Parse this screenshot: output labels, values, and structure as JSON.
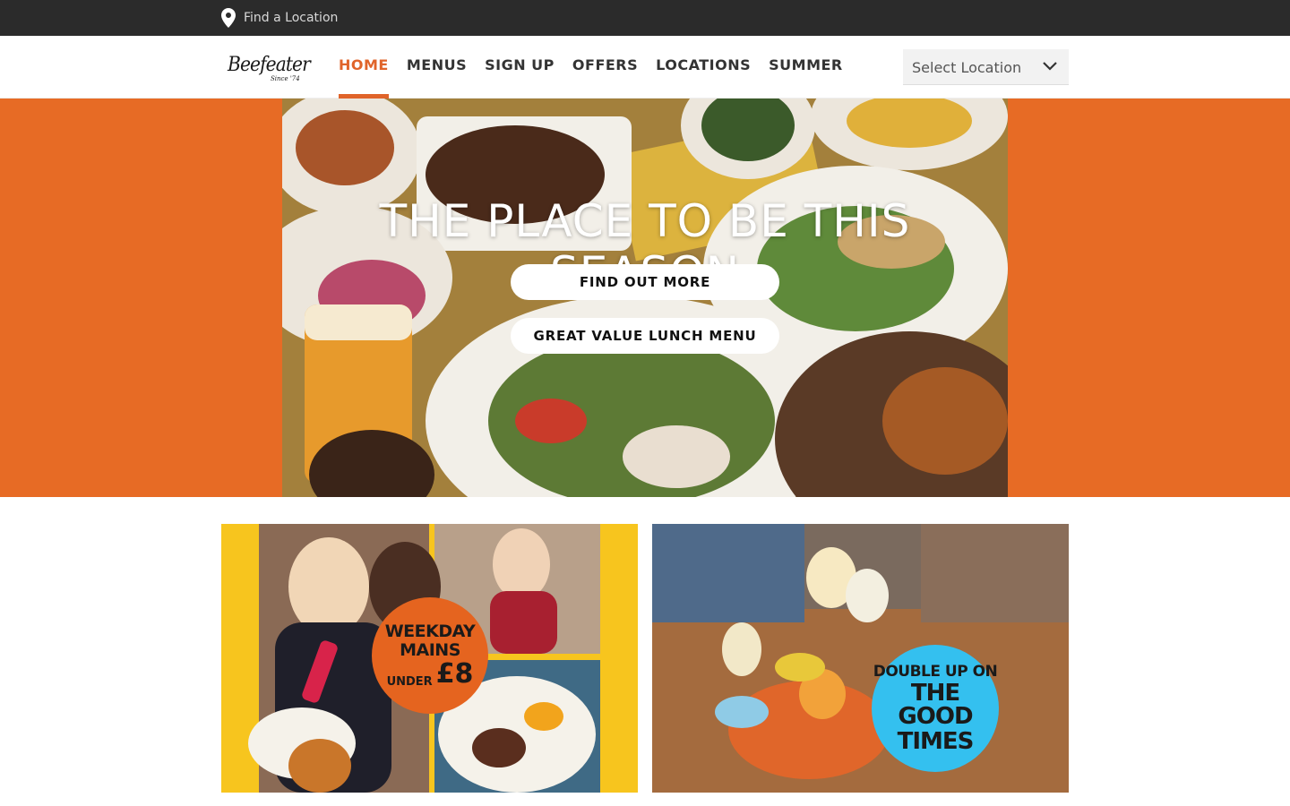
{
  "topbar": {
    "find_location": "Find a Location"
  },
  "brand": {
    "name": "Beefeater",
    "tagline": "Since '74"
  },
  "nav": {
    "items": [
      {
        "label": "HOME"
      },
      {
        "label": "MENUS"
      },
      {
        "label": "SIGN UP"
      },
      {
        "label": "OFFERS"
      },
      {
        "label": "LOCATIONS"
      },
      {
        "label": "SUMMER"
      }
    ],
    "active": "HOME"
  },
  "location_select": {
    "value": "Select Location"
  },
  "hero": {
    "title": "THE PLACE TO BE THIS SEASON",
    "buttons": [
      {
        "label": "FIND OUT MORE"
      },
      {
        "label": "GREAT VALUE LUNCH MENU"
      }
    ]
  },
  "promos": {
    "left": {
      "badge": [
        "WEEKDAY",
        "MAINS",
        "UNDER",
        "£8"
      ]
    },
    "right": {
      "badge": [
        "DOUBLE UP ON",
        "THE GOOD",
        "TIMES"
      ]
    }
  },
  "colors": {
    "accent": "#e0642a",
    "hero_bg": "#e76b25",
    "topbar_bg": "#2b2b2b",
    "promo_yellow": "#f7c51e",
    "badge_blue": "#34c0ef"
  }
}
